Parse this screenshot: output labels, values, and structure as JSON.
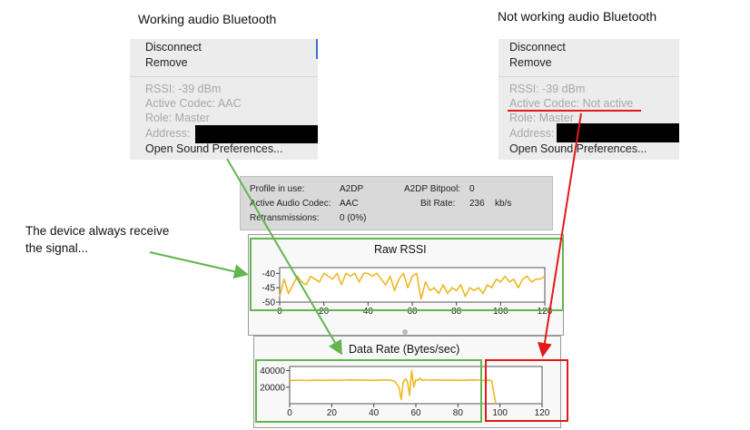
{
  "captions": {
    "working": "Working audio Bluetooth",
    "not_working": "Not working audio Bluetooth"
  },
  "menu_working": {
    "disconnect": "Disconnect",
    "remove": "Remove",
    "rssi": "RSSI: -39 dBm",
    "codec": "Active Codec: AAC",
    "role": "Role: Master",
    "address": "Address:",
    "sound_prefs": "Open Sound Preferences..."
  },
  "menu_not_working": {
    "disconnect": "Disconnect",
    "remove": "Remove",
    "rssi": "RSSI: -39 dBm",
    "codec": "Active Codec: Not active",
    "role": "Role: Master",
    "address": "Address:",
    "sound_prefs": "Open Sound Preferences..."
  },
  "info_panel": {
    "profile_label": "Profile in use:",
    "profile_value": "A2DP",
    "codec_label": "Active Audio Codec:",
    "codec_value": "AAC",
    "retrans_label": "Retransmissions:",
    "retrans_value": "0 (0%)",
    "bitpool_label": "A2DP Bitpool:",
    "bitpool_value": "0",
    "bitrate_label": "Bit Rate:",
    "bitrate_value": "236",
    "bitrate_unit": "kb/s"
  },
  "annotation": {
    "line1": "The device always receive",
    "line2": "the signal..."
  },
  "colors": {
    "green": "#62b54f",
    "red": "#e01919",
    "series": "#f0b723"
  },
  "chart_data": [
    {
      "type": "line",
      "title": "Raw RSSI",
      "xlim": [
        0,
        120
      ],
      "ylim": [
        -50,
        -38
      ],
      "xticks": [
        0,
        20,
        40,
        60,
        80,
        100,
        120
      ],
      "yticks": [
        -40,
        -45,
        -50
      ],
      "x": [
        0,
        2,
        4,
        6,
        8,
        10,
        12,
        14,
        16,
        18,
        20,
        22,
        24,
        26,
        28,
        30,
        32,
        34,
        36,
        38,
        40,
        42,
        44,
        46,
        48,
        50,
        52,
        54,
        56,
        58,
        60,
        62,
        64,
        66,
        68,
        70,
        72,
        74,
        76,
        78,
        80,
        82,
        84,
        86,
        88,
        90,
        92,
        94,
        96,
        98,
        100,
        102,
        104,
        106,
        108,
        110,
        112,
        114,
        116,
        118,
        120
      ],
      "series": [
        {
          "values": [
            -48,
            -42,
            -47,
            -44,
            -41,
            -43,
            -44,
            -41,
            -42,
            -43,
            -40,
            -41,
            -42,
            -40,
            -44,
            -40,
            -41,
            -40,
            -43,
            -40,
            -40,
            -41,
            -40,
            -42,
            -44,
            -41,
            -46,
            -42,
            -40,
            -45,
            -41,
            -40,
            -49,
            -43,
            -46,
            -45,
            -47,
            -44,
            -47,
            -45,
            -46,
            -44,
            -48,
            -45,
            -46,
            -45,
            -47,
            -44,
            -45,
            -42,
            -43,
            -41,
            -43,
            -42,
            -45,
            -42,
            -41,
            -43,
            -42,
            -42,
            -41
          ]
        }
      ]
    },
    {
      "type": "line",
      "title": "Data Rate (Bytes/sec)",
      "xlim": [
        0,
        120
      ],
      "ylim": [
        0,
        45000
      ],
      "xticks": [
        0,
        20,
        40,
        60,
        80,
        100,
        120
      ],
      "yticks": [
        40000,
        20000
      ],
      "x": [
        0,
        4,
        8,
        12,
        16,
        20,
        24,
        28,
        32,
        36,
        40,
        44,
        48,
        50,
        52,
        53,
        54,
        55,
        56,
        57,
        58,
        59,
        60,
        61,
        62,
        63,
        64,
        66,
        70,
        74,
        78,
        82,
        86,
        90,
        92,
        94,
        96,
        97,
        98
      ],
      "series": [
        {
          "values": [
            28000,
            28500,
            28000,
            28600,
            28200,
            28700,
            28300,
            28800,
            28400,
            28600,
            28200,
            28800,
            28400,
            27000,
            20000,
            5000,
            26000,
            30000,
            27000,
            10000,
            40000,
            20000,
            29000,
            28000,
            31000,
            28000,
            29000,
            28500,
            28800,
            28300,
            28700,
            28200,
            28800,
            28500,
            28000,
            28700,
            28000,
            14000,
            0
          ]
        }
      ]
    }
  ]
}
